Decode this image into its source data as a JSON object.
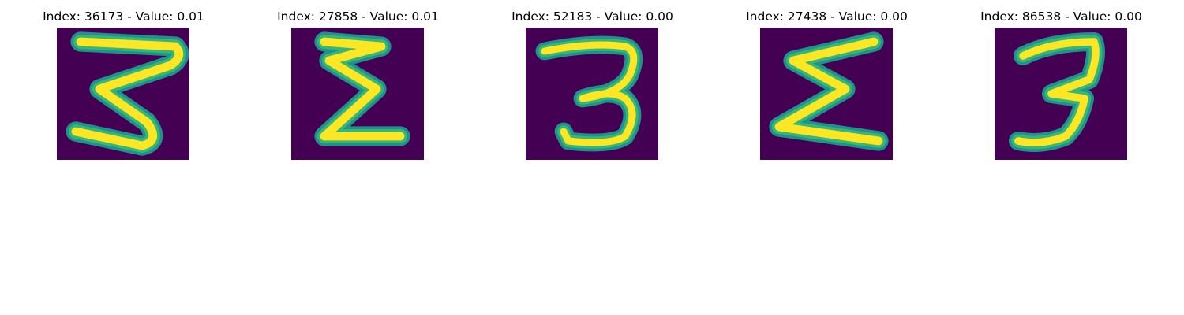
{
  "panels": [
    {
      "title": "Index: 36173 - Value: 0.01",
      "digit": "3",
      "image_name": "digit-3-image"
    },
    {
      "title": "Index: 27858 - Value: 0.01",
      "digit": "3",
      "image_name": "digit-3-image"
    },
    {
      "title": "Index: 52183 - Value: 0.00",
      "digit": "3",
      "image_name": "digit-3-image"
    },
    {
      "title": "Index: 27438 - Value: 0.00",
      "digit": "3",
      "image_name": "digit-3-image"
    },
    {
      "title": "Index: 86538 - Value: 0.00",
      "digit": "3",
      "image_name": "digit-3-image"
    }
  ],
  "colors": {
    "background": "#440154",
    "stroke_core": "#fde725",
    "stroke_mid": "#35b779",
    "stroke_edge": "#21918c"
  }
}
